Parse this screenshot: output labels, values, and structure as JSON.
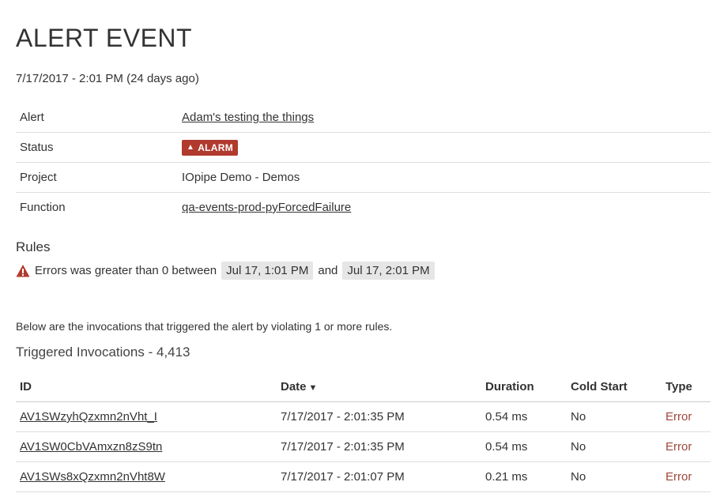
{
  "header": {
    "title": "ALERT EVENT",
    "timestamp": "7/17/2017 - 2:01 PM (24 days ago)"
  },
  "details": {
    "alert_label": "Alert",
    "alert_value": "Adam's testing the things",
    "status_label": "Status",
    "status_value": "ALARM",
    "project_label": "Project",
    "project_value": "IOpipe Demo - Demos",
    "function_label": "Function",
    "function_value": "qa-events-prod-pyForcedFailure"
  },
  "rules": {
    "heading": "Rules",
    "text_before": "Errors was greater than 0 between",
    "start": "Jul 17, 1:01 PM",
    "and": "and",
    "end": "Jul 17, 2:01 PM"
  },
  "invocations": {
    "intro": "Below are the invocations that triggered the alert by violating 1 or more rules.",
    "heading": "Triggered Invocations - 4,413",
    "columns": {
      "id": "ID",
      "date": "Date",
      "duration": "Duration",
      "cold_start": "Cold Start",
      "type": "Type"
    },
    "rows": [
      {
        "id": "AV1SWzyhQzxmn2nVht_I",
        "date": "7/17/2017 - 2:01:35 PM",
        "duration": "0.54 ms",
        "cold_start": "No",
        "type": "Error"
      },
      {
        "id": "AV1SW0CbVAmxzn8zS9tn",
        "date": "7/17/2017 - 2:01:35 PM",
        "duration": "0.54 ms",
        "cold_start": "No",
        "type": "Error"
      },
      {
        "id": "AV1SWs8xQzxmn2nVht8W",
        "date": "7/17/2017 - 2:01:07 PM",
        "duration": "0.21 ms",
        "cold_start": "No",
        "type": "Error"
      }
    ]
  },
  "colors": {
    "alarm": "#b03a2e",
    "error_text": "#a0463a"
  }
}
